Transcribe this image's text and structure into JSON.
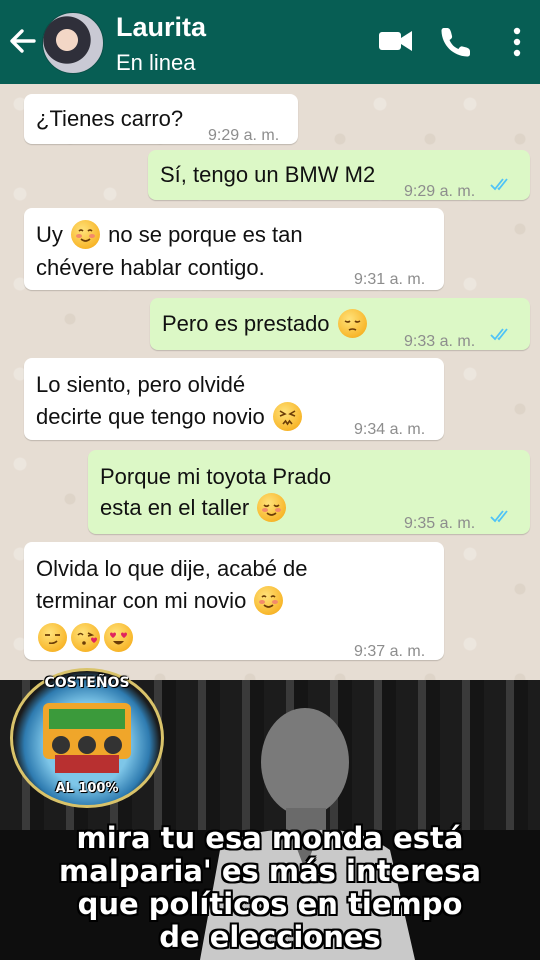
{
  "header": {
    "contact_name": "Laurita",
    "status": "En linea",
    "icons": [
      "back-arrow-icon",
      "video-call-icon",
      "phone-icon",
      "more-options-icon"
    ]
  },
  "messages": [
    {
      "direction": "in",
      "line1": "¿Tienes carro?",
      "time": "9:29 a. m."
    },
    {
      "direction": "out",
      "line1": "Sí, tengo un BMW M2",
      "time": "9:29 a. m.",
      "status": "read"
    },
    {
      "direction": "in",
      "line1_a": "Uy",
      "line1_b": "no se porque es tan",
      "line2": "chévere hablar contigo.",
      "time": "9:31 a. m.",
      "emoji": "smiling-blush-emoji"
    },
    {
      "direction": "out",
      "line1": "Pero es prestado",
      "time": "9:33 a. m.",
      "status": "read",
      "emoji": "pensive-emoji"
    },
    {
      "direction": "in",
      "line1": "Lo siento, pero olvidé",
      "line2": "decirte que tengo novio",
      "time": "9:34 a. m.",
      "emoji": "confounded-emoji"
    },
    {
      "direction": "out",
      "line1": "Porque mi toyota Prado",
      "line2": "esta en el taller",
      "time": "9:35 a. m.",
      "status": "read",
      "emoji": "relieved-emoji"
    },
    {
      "direction": "in",
      "line1": "Olvida lo que dije, acabé de",
      "line2": "terminar con mi novio",
      "time": "9:37 a. m.",
      "emojis": [
        "smirk-emoji",
        "kissing-heart-emoji",
        "heart-eyes-emoji"
      ]
    }
  ],
  "meme": {
    "logo_top": "COSTEÑOS",
    "logo_bottom": "AL 100%",
    "caption_lines": [
      "mira tu esa monda está",
      "malparia' es más interesa",
      "que políticos en tiempo",
      "de elecciones"
    ]
  },
  "colors": {
    "header": "#075e54",
    "outgoing_bubble": "#dcf8c6",
    "incoming_bubble": "#ffffff",
    "read_ticks": "#4fc3f7"
  }
}
